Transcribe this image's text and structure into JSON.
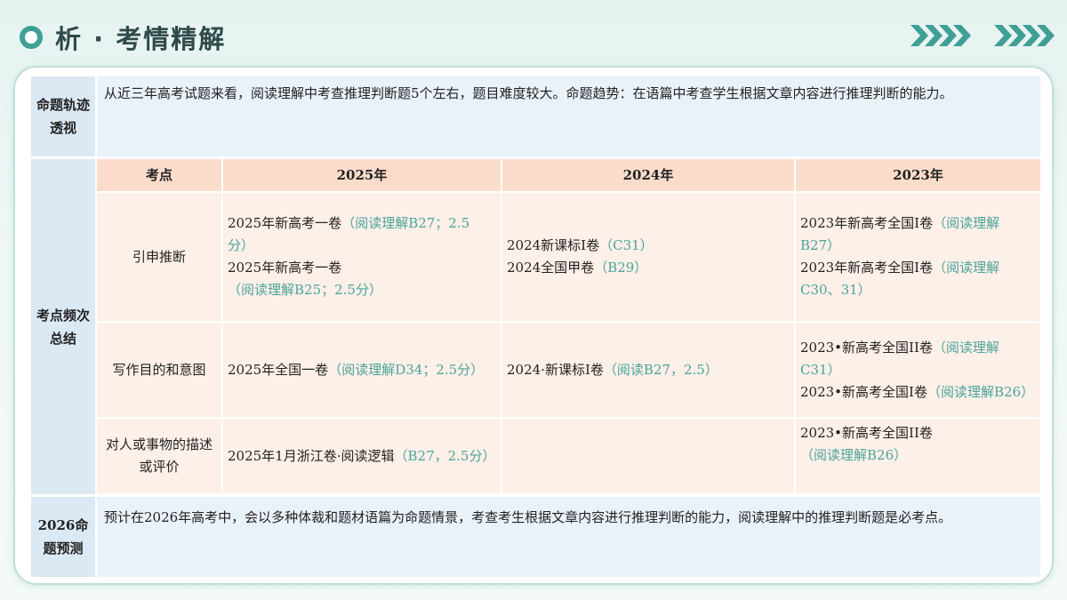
{
  "header": {
    "title": "析 · 考情精解"
  },
  "trend": {
    "label": "命题轨迹透视",
    "text": "从近三年高考试题来看，阅读理解中考查推理判断题5个左右，题目难度较大。命题趋势：在语篇中考查学生根据文章内容进行推理判断的能力。"
  },
  "summary": {
    "label": "考点频次总结",
    "headers": [
      "考点",
      "2025年",
      "2024年",
      "2023年"
    ],
    "rows": [
      {
        "point": "引申推断",
        "y2025": [
          {
            "main": "2025年新高考一卷",
            "note": "（阅读理解B27；2.5分）"
          },
          {
            "main": "2025年新高考一卷",
            "note": "（阅读理解B25；2.5分）"
          }
        ],
        "y2024": [
          {
            "main": "2024新课标I卷",
            "note": "（C31）"
          },
          {
            "main": "2024全国甲卷",
            "note": "（B29）"
          }
        ],
        "y2023": [
          {
            "main": " 2023年新高考全国I卷",
            "note": "（阅读理解B27）"
          },
          {
            "main": "2023年新高考全国I卷",
            "note": "（阅读理解C30、31）"
          }
        ]
      },
      {
        "point": "写作目的和意图",
        "y2025": [
          {
            "main": "2025年全国一卷",
            "note": "（阅读理解D34；2.5分）"
          }
        ],
        "y2024": [
          {
            "main": "2024·新课标I卷",
            "note": "（阅读B27，2.5）"
          }
        ],
        "y2023": [
          {
            "main": "2023•新高考全国II卷",
            "note": "（阅读理解C31）"
          },
          {
            "main": "2023•新高考全国I卷",
            "note": "（阅读理解B26）"
          }
        ]
      },
      {
        "point": "对人或事物的描述或评价",
        "y2025": [
          {
            "main": "2025年1月浙江卷·阅读逻辑",
            "note": "（B27，2.5分）"
          }
        ],
        "y2024": [],
        "y2023": [
          {
            "main": "2023•新高考全国II卷",
            "note": "（阅读理解B26）"
          }
        ]
      }
    ]
  },
  "forecast": {
    "label": "2026命题预测",
    "text": "预计在2026年高考中，会以多种体裁和题材语篇为命题情景，考查考生根据文章内容进行推理判断的能力，阅读理解中的推理判断题是必考点。"
  },
  "colors": {
    "accent": "#3f9f95",
    "note_teal": "#4ba39a",
    "blue_row": "#e9f1f9",
    "peach_header": "#fbdccb",
    "peach_cell": "#fdf0e8"
  },
  "icons": [
    "chevron-right-icon",
    "title-dot-icon"
  ]
}
